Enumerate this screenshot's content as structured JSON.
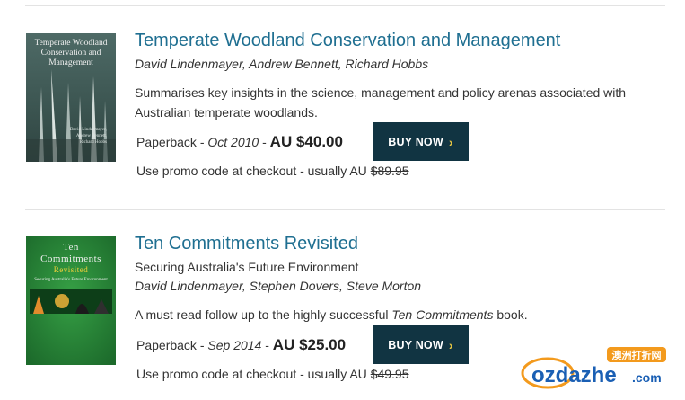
{
  "books": [
    {
      "cover": {
        "title": "Temperate Woodland Conservation and Management",
        "authors": "David Lindenmayer, Andrew Bennett, Richard Hobbs",
        "colors": {
          "bg": "#3f5a57",
          "accent": "#c7d3cf"
        }
      },
      "title": "Temperate Woodland Conservation and Management",
      "subtitle": "",
      "authors": "David Lindenmayer, Andrew Bennett, Richard Hobbs",
      "description_plain": "Summarises key insights in the science, management and policy arenas associated with Australian temperate woodlands.",
      "format": "Paperback",
      "date": "Oct 2010",
      "price": "AU $40.00",
      "buy_label": "BUY NOW",
      "promo_text": "Use promo code at checkout - usually AU",
      "promo_old_price": "$89.95"
    },
    {
      "cover": {
        "title_line1": "Ten",
        "title_line2": "Commitments",
        "title_line3": "Revisited",
        "subtitle": "Securing Australia's Future Environment",
        "colors": {
          "bg": "#2b8a3a",
          "dark": "#0f4d1c"
        }
      },
      "title": "Ten Commitments Revisited",
      "subtitle": "Securing Australia's Future Environment",
      "authors": "David Lindenmayer, Stephen Dovers, Steve Morton",
      "description_prefix": "A must read follow up to the highly successful",
      "description_italic": "Ten Commitments",
      "description_suffix": "book.",
      "format": "Paperback",
      "date": "Sep 2014",
      "price": "AU $25.00",
      "buy_label": "BUY NOW",
      "promo_text": "Use promo code at checkout - usually AU",
      "promo_old_price": "$49.95"
    }
  ],
  "watermark": {
    "cn": "澳洲打折网",
    "latin": "ozdazhe",
    "domain": ".com",
    "colors": {
      "primary": "#1a5fb4",
      "accent": "#f39a1d"
    }
  },
  "colors": {
    "link": "#1f6f91",
    "button": "#113442",
    "chevron": "#e9c843"
  }
}
